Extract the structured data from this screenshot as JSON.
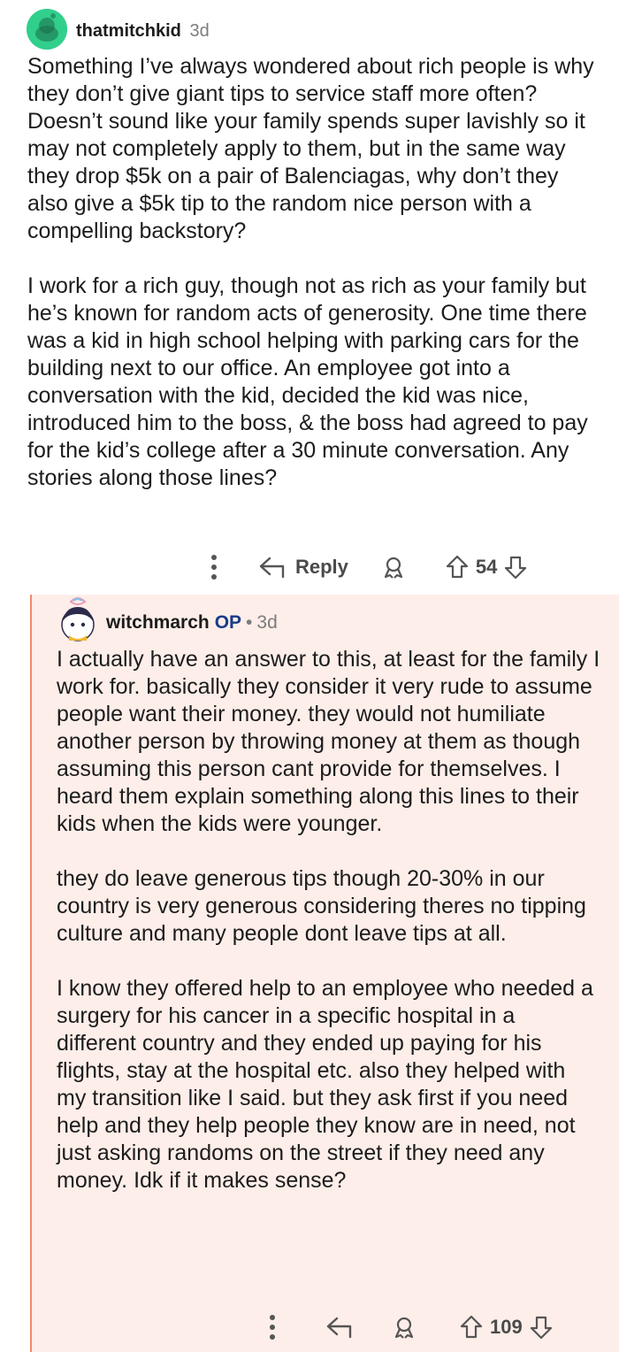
{
  "comment1": {
    "username": "thatmitchkid",
    "age": "3d",
    "paragraphs": [
      "Something I’ve always wondered about rich people is why they don’t give giant tips to service staff more often? Doesn’t sound like your family spends super lavishly so it may not completely apply to them, but in the same way they drop $5k on a pair of Balenciagas, why don’t they also give a $5k tip to the random nice person with a compelling backstory?",
      "I work for a rich guy, though not as rich as your family but he’s known for random acts of generosity. One time there was a kid in high school helping with parking cars for the building next to our office. An employee got into a conversation with the kid, decided the kid was nice, introduced him to the boss, & the boss had agreed to pay for the kid’s college after a 30 minute conversation. Any stories along those lines?"
    ],
    "actions": {
      "reply_label": "Reply",
      "votes": "54"
    },
    "avatar_color": "#31cf8c"
  },
  "comment2": {
    "username": "witchmarch",
    "op_badge": "OP",
    "separator": "•",
    "age": "3d",
    "paragraphs": [
      "I actually have an answer to this, at least for the family I work for. basically they consider it very rude to assume people want their money. they would not humiliate another person by throwing money at them as though assuming this person cant provide for themselves. I heard them explain something along this lines to their kids when the kids were younger.",
      "they do leave generous tips though 20-30% in our country is very generous considering theres no tipping culture and many people dont leave tips at all.",
      "I know they offered help to an employee who needed a surgery for his cancer in a specific hospital in a different country and they ended up paying for his flights, stay at the hospital etc. also they helped with my transition like I said. but they ask first if you need help and they help people they know are in need, not just asking randoms on the street if they need any money. Idk if it makes sense?"
    ],
    "actions": {
      "votes": "109"
    },
    "background_color": "#fdeee9",
    "thread_line_color": "#ef8b6b"
  },
  "icons": [
    "more-options-icon",
    "reply-arrow-icon",
    "award-icon",
    "upvote-icon",
    "downvote-icon",
    "snoo-avatar-icon"
  ]
}
